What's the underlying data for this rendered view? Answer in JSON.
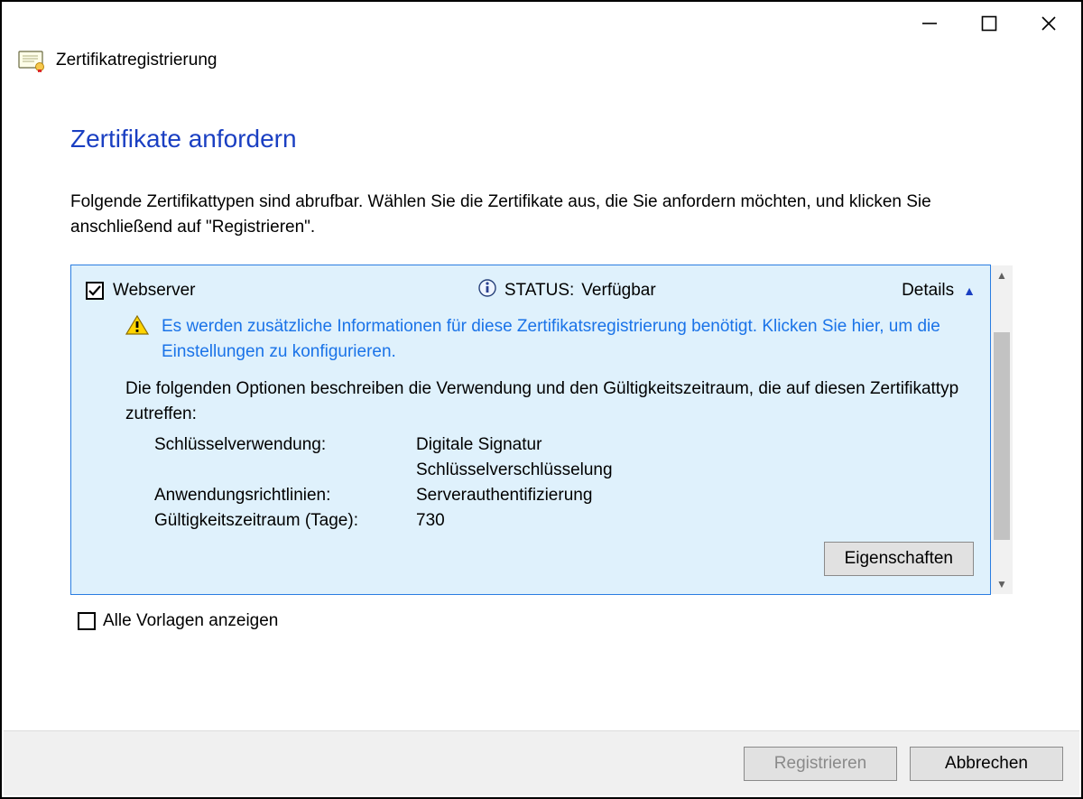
{
  "header": {
    "title": "Zertifikatregistrierung"
  },
  "heading": "Zertifikate anfordern",
  "intro": "Folgende Zertifikattypen sind abrufbar. Wählen Sie die Zertifikate aus, die Sie anfordern möchten, und klicken Sie anschließend auf \"Registrieren\".",
  "template": {
    "name": "Webserver",
    "status_label": "STATUS:",
    "status_value": "Verfügbar",
    "details_label": "Details",
    "warning": "Es werden zusätzliche Informationen für diese Zertifikatsregistrierung benötigt. Klicken Sie hier, um die Einstellungen zu konfigurieren.",
    "options_desc": "Die folgenden Optionen beschreiben die Verwendung und den Gültigkeitszeitraum, die auf diesen Zertifikattyp zutreffen:",
    "key_usage_label": "Schlüsselverwendung:",
    "key_usage_value1": "Digitale Signatur",
    "key_usage_value2": "Schlüsselverschlüsselung",
    "app_policy_label": "Anwendungsrichtlinien:",
    "app_policy_value": "Serverauthentifizierung",
    "validity_label": "Gültigkeitszeitraum (Tage):",
    "validity_value": "730",
    "properties_btn": "Eigenschaften"
  },
  "show_all_label": "Alle Vorlagen anzeigen",
  "footer": {
    "register": "Registrieren",
    "cancel": "Abbrechen"
  }
}
